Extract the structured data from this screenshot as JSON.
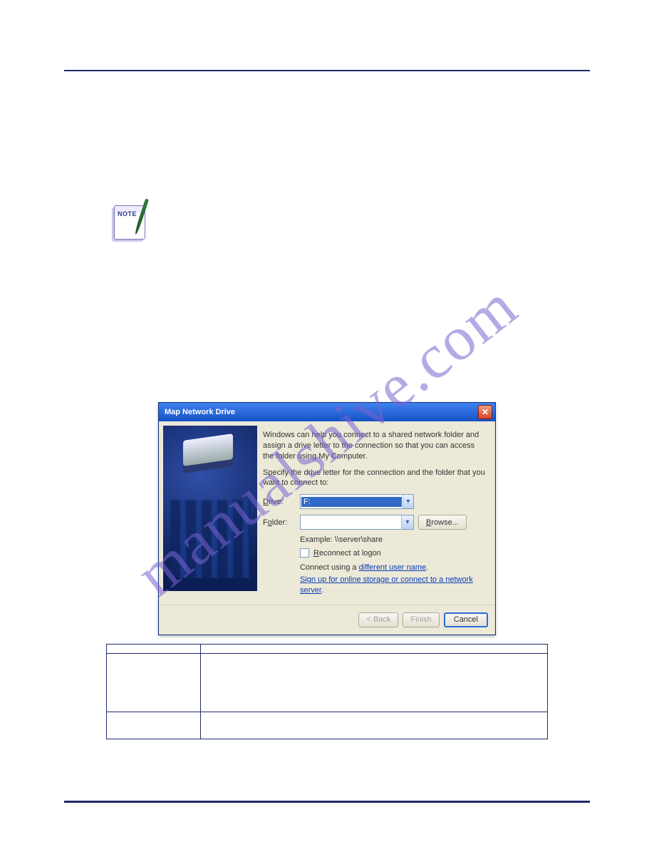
{
  "dialog": {
    "title": "Map Network Drive",
    "intro1": "Windows can help you connect to a shared network folder and assign a drive letter to the connection so that you can access the folder using My Computer.",
    "intro2": "Specify the drive letter for the connection and the folder that you want to connect to:",
    "drive_label": "Drive:",
    "drive_value": "F:",
    "folder_label": "Folder:",
    "folder_value": "",
    "browse": "Browse...",
    "example": "Example: \\\\server\\share",
    "reconnect_prefix": "R",
    "reconnect_rest": "econnect at logon",
    "connect_prefix": "Connect using a ",
    "connect_link": "different user name",
    "signup_link_prefix": "Sign up for online storage or connect to a network server",
    "back": "< Back",
    "finish": "Finish",
    "cancel": "Cancel"
  },
  "watermark": "manualshive.com"
}
